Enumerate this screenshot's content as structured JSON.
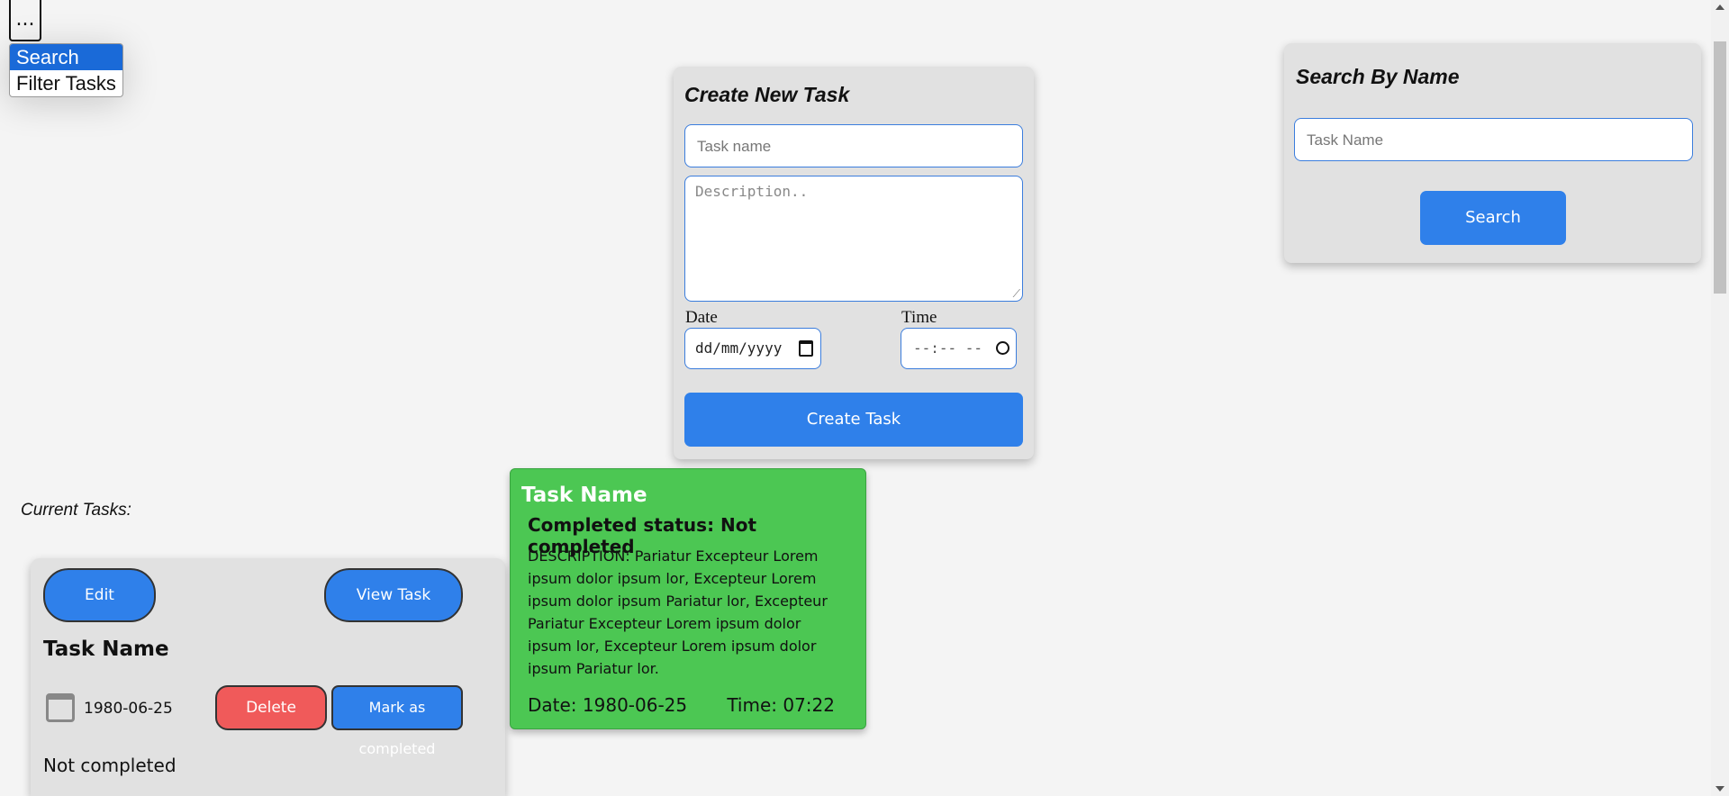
{
  "menu": {
    "toggle": "...",
    "items": [
      "Search",
      "Filter Tasks"
    ]
  },
  "create": {
    "title": "Create New Task",
    "task_name_placeholder": "Task name",
    "description_placeholder": "Description..",
    "date_label": "Date",
    "date_value": "dd/mm/yyyy",
    "time_label": "Time",
    "time_value": "--:-- --",
    "submit": "Create Task"
  },
  "search": {
    "title": "Search By Name",
    "placeholder": "Task Name",
    "button": "Search"
  },
  "tasks": {
    "heading": "Current Tasks:",
    "card": {
      "edit": "Edit",
      "view": "View Task",
      "name": "Task Name",
      "date": "1980-06-25",
      "delete": "Delete",
      "complete": "Mark as completed",
      "status": "Not completed"
    }
  },
  "detail": {
    "name": "Task Name",
    "status": "Completed status: Not completed",
    "description": "DESCRIPTION: Pariatur Excepteur Lorem ipsum dolor ipsum lor, Excepteur Lorem ipsum dolor ipsum Pariatur lor, Excepteur Pariatur Excepteur Lorem ipsum dolor ipsum lor, Excepteur Lorem ipsum dolor ipsum Pariatur lor.",
    "date": "Date: 1980-06-25",
    "time": "Time: 07:22"
  },
  "colors": {
    "accent": "#2f80ea",
    "danger": "#f05a5a",
    "success": "#4cc753",
    "panel": "#e1e1e1"
  }
}
